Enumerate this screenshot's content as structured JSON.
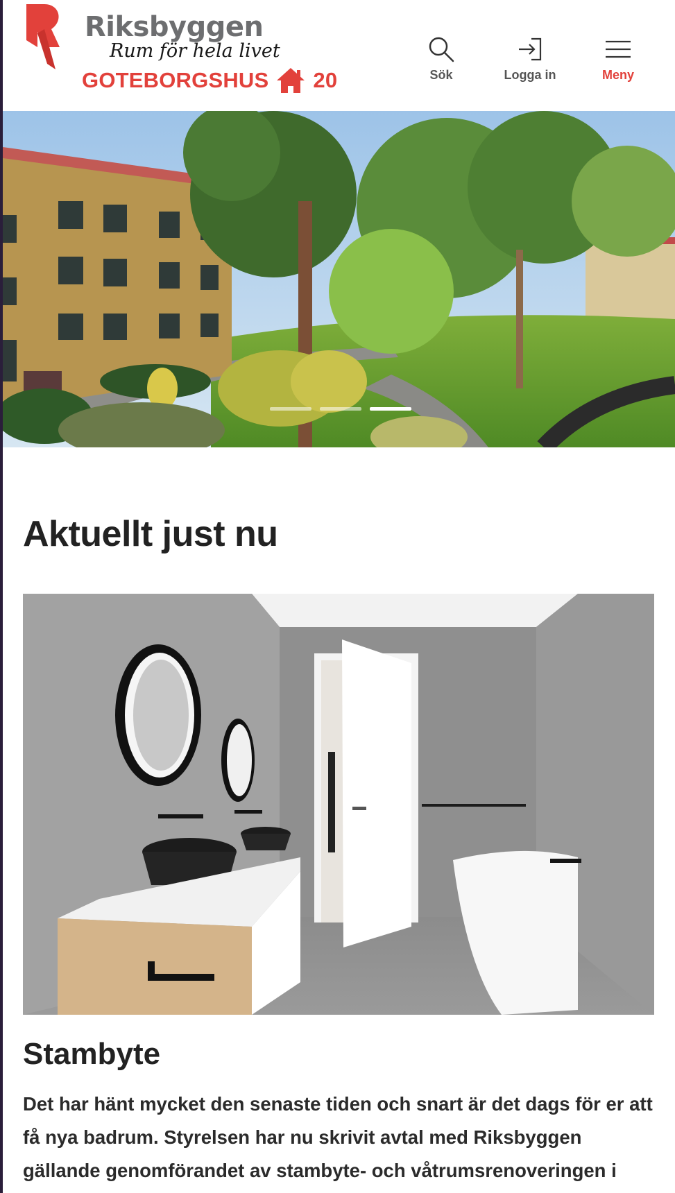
{
  "header": {
    "brand_name": "Riksbyggen",
    "tagline": "Rum för hela livet",
    "sub_brand": "GOTEBORGSHUS",
    "sub_brand_number": "20",
    "brand_color": "#e2413b",
    "nav": {
      "search_label": "Sök",
      "login_label": "Logga in",
      "menu_label": "Meny"
    }
  },
  "hero": {
    "slide_count": 3,
    "active_slide": 3
  },
  "main": {
    "section_title": "Aktuellt just nu",
    "article": {
      "title": "Stambyte",
      "body": "Det har hänt mycket den senaste tiden och snart är det dags för er att få nya badrum. Styrelsen har nu skrivit avtal med Riksbyggen gällande genomförandet av stambyte- och våtrumsrenoveringen i"
    }
  }
}
